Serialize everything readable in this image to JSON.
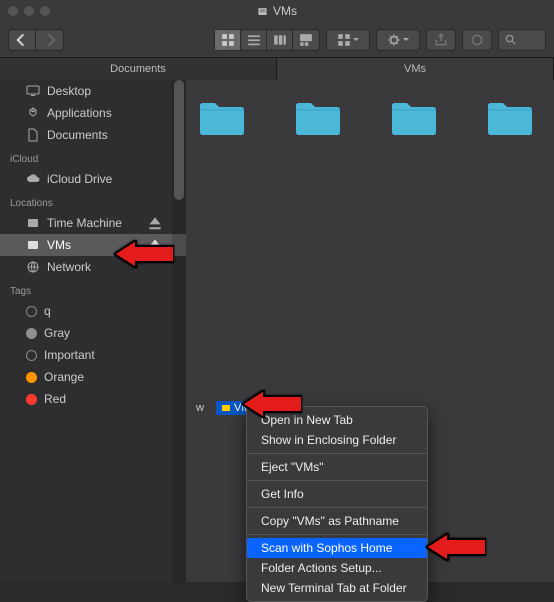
{
  "window_title": "VMs",
  "tabs": [
    "Documents",
    "VMs"
  ],
  "active_tab": 1,
  "sidebar": {
    "favorites": [
      {
        "label": "Desktop"
      },
      {
        "label": "Applications"
      },
      {
        "label": "Documents"
      }
    ],
    "icloud_head": "iCloud",
    "icloud": [
      {
        "label": "iCloud Drive"
      }
    ],
    "locations_head": "Locations",
    "locations": [
      {
        "label": "Time Machine",
        "eject": true
      },
      {
        "label": "VMs",
        "eject": true,
        "selected": true
      },
      {
        "label": "Network"
      }
    ],
    "tags_head": "Tags",
    "tags": [
      {
        "label": "q",
        "color": "transparent"
      },
      {
        "label": "Gray",
        "color": "#8e8e93"
      },
      {
        "label": "Important",
        "color": "transparent"
      },
      {
        "label": "Orange",
        "color": "#ff9500"
      },
      {
        "label": "Red",
        "color": "#ff3b30"
      }
    ]
  },
  "pathbar": {
    "w": "w",
    "chip": "VMs"
  },
  "context_menu": {
    "items": [
      "Open in New Tab",
      "Show in Enclosing Folder",
      "-",
      "Eject \"VMs\"",
      "-",
      "Get Info",
      "-",
      "Copy \"VMs\" as Pathname",
      "-",
      "Scan with Sophos Home",
      "Folder Actions Setup...",
      "New Terminal Tab at Folder"
    ],
    "highlighted": "Scan with Sophos Home"
  }
}
